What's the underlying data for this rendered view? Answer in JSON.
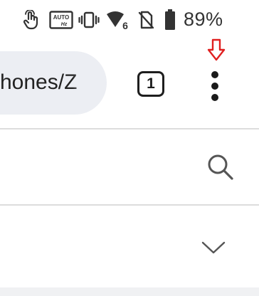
{
  "status_bar": {
    "battery_percent": "89%",
    "icons": [
      "touch-icon",
      "auto-hz-icon",
      "vibrate-icon",
      "wifi-6-icon",
      "no-sim-icon",
      "battery-icon"
    ],
    "auto_hz_top": "AUTO",
    "auto_hz_bottom": "Hz",
    "wifi_badge": "6"
  },
  "toolbar": {
    "url_text": "hones/Z",
    "tab_count": "1",
    "menu_icon": "more-vert-icon",
    "annotation_arrow_color": "#e02020"
  },
  "content": {
    "search_icon": "search-icon",
    "expand_icon": "chevron-down-icon"
  }
}
